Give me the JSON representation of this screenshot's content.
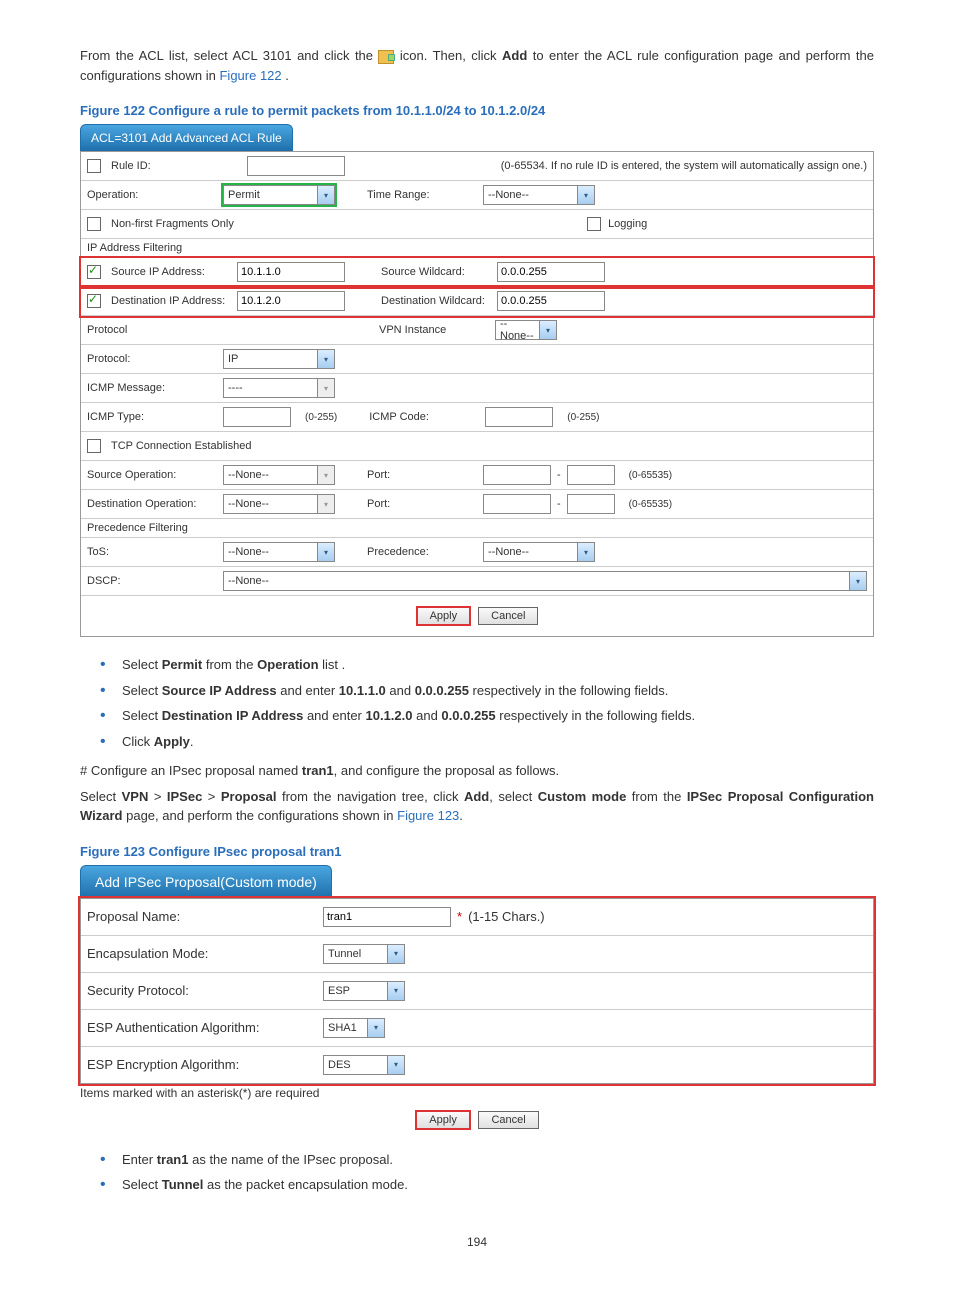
{
  "intro": {
    "t1": "From the ACL list, select ACL 3101 and click the ",
    "t2": " icon. Then, click ",
    "add": "Add",
    "t3": " to enter the ACL rule configuration page and perform the configurations shown in ",
    "figref": "Figure 122",
    "dot": "."
  },
  "fig122": {
    "caption": "Figure 122 Configure a rule to permit packets from 10.1.1.0/24 to 10.1.2.0/24",
    "tab": "ACL=3101 Add Advanced ACL Rule",
    "rule_id_label": "Rule ID:",
    "rule_note": "(0-65534. If no rule ID is entered, the system will automatically assign one.)",
    "operation_label": "Operation:",
    "operation_val": "Permit",
    "time_range_label": "Time Range:",
    "time_range_val": "--None--",
    "nonfirst_label": "Non-first Fragments Only",
    "logging_label": "Logging",
    "ip_filter_section": "IP Address Filtering",
    "src_ip_label": "Source IP Address:",
    "src_ip_val": "10.1.1.0",
    "src_wild_label": "Source Wildcard:",
    "src_wild_val": "0.0.0.255",
    "dst_ip_label": "Destination IP Address:",
    "dst_ip_val": "10.1.2.0",
    "dst_wild_label": "Destination Wildcard:",
    "dst_wild_val": "0.0.0.255",
    "protocol_section": "Protocol",
    "vpn_label": "VPN Instance",
    "vpn_val": "--None--",
    "proto_label": "Protocol:",
    "proto_val": "IP",
    "icmp_msg_label": "ICMP Message:",
    "icmp_msg_val": "----",
    "icmp_type_label": "ICMP Type:",
    "icmp_type_range": "(0-255)",
    "icmp_code_label": "ICMP Code:",
    "tcp_label": "TCP Connection Established",
    "src_op_label": "Source Operation:",
    "none_val": "--None--",
    "port_label": "Port:",
    "port_range": "(0-65535)",
    "dst_op_label": "Destination Operation:",
    "prec_section": "Precedence Filtering",
    "tos_label": "ToS:",
    "prec_label": "Precedence:",
    "dscp_label": "DSCP:",
    "apply": "Apply",
    "cancel": "Cancel"
  },
  "bullets1": {
    "b1a": "Select ",
    "b1b": "Permit",
    "b1c": " from the ",
    "b1d": "Operation",
    "b1e": " list .",
    "b2a": "Select ",
    "b2b": "Source IP Address",
    "b2c": " and enter ",
    "b2d": "10.1.1.0",
    "b2e": " and ",
    "b2f": "0.0.0.255",
    "b2g": " respectively in the following fields.",
    "b3a": "Select ",
    "b3b": "Destination IP Address",
    "b3c": " and enter ",
    "b3d": "10.1.2.0",
    "b3e": " and ",
    "b3f": "0.0.0.255",
    "b3g": " respectively in the following fields.",
    "b4a": "Click ",
    "b4b": "Apply",
    "b4c": "."
  },
  "para2": {
    "t1": "# Configure an IPsec proposal named ",
    "t2": "tran1",
    "t3": ", and configure the proposal as follows."
  },
  "para3": {
    "t1": "Select ",
    "vpn": "VPN",
    "gt": " > ",
    "ipsec": "IPSec",
    "proposal": "Proposal",
    "t2": " from the navigation tree, click ",
    "add": "Add",
    "t3": ", select ",
    "custom": "Custom mode",
    "t4": " from the ",
    "wizard": "IPSec Proposal Configuration Wizard",
    "t5": " page, and perform the configurations shown in ",
    "figref": "Figure 123",
    "dot": "."
  },
  "fig123": {
    "caption": "Figure 123 Configure IPsec proposal tran1",
    "tab": "Add IPSec Proposal(Custom mode)",
    "name_label": "Proposal Name:",
    "name_val": "tran1",
    "name_note": "(1-15 Chars.)",
    "encap_label": "Encapsulation Mode:",
    "encap_val": "Tunnel",
    "sec_label": "Security Protocol:",
    "sec_val": "ESP",
    "auth_label": "ESP Authentication Algorithm:",
    "auth_val": "SHA1",
    "enc_label": "ESP Encryption Algorithm:",
    "enc_val": "DES",
    "note": "Items marked with an asterisk(*) are required",
    "apply": "Apply",
    "cancel": "Cancel"
  },
  "bullets2": {
    "b1a": "Enter ",
    "b1b": "tran1",
    "b1c": " as the name of the IPsec proposal.",
    "b2a": "Select ",
    "b2b": "Tunnel",
    "b2c": " as the packet encapsulation mode."
  },
  "page": "194"
}
